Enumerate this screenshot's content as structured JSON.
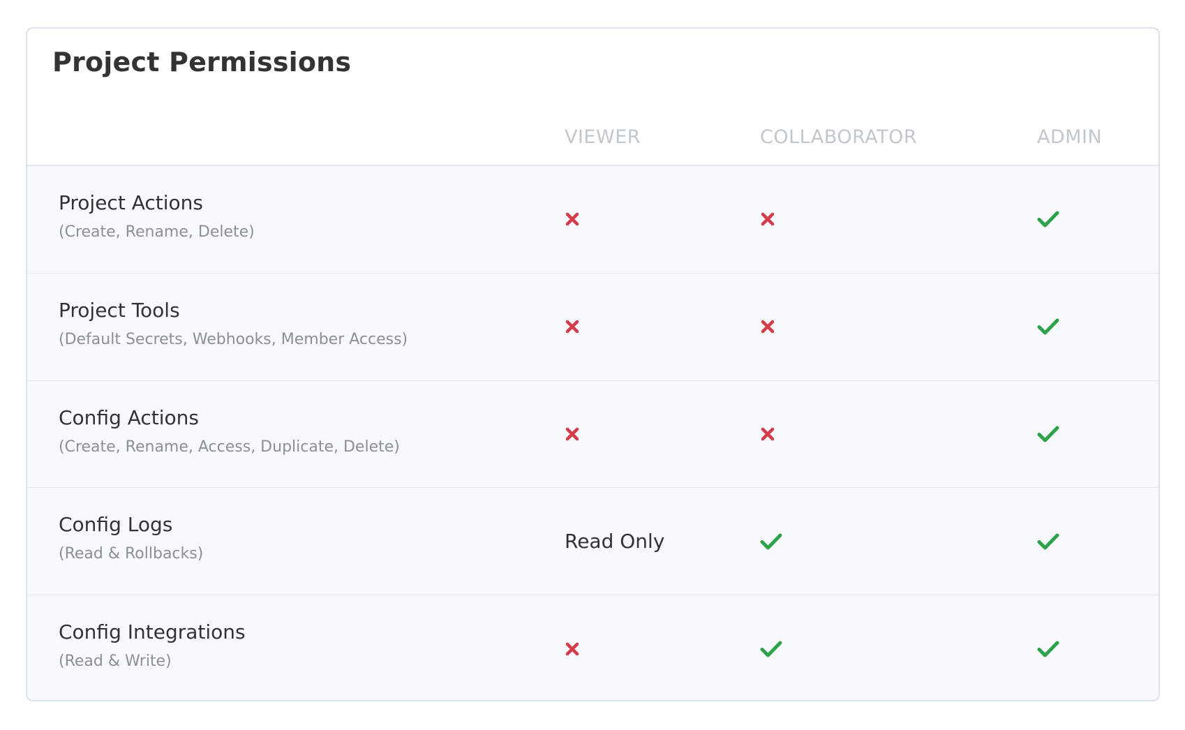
{
  "title": "Project Permissions",
  "columns": [
    "VIEWER",
    "COLLABORATOR",
    "ADMIN"
  ],
  "colors": {
    "allowed": "#2ea24a",
    "denied": "#d73a49",
    "header_text": "#c2c7cc",
    "row_background": "#f7f9fc"
  },
  "rows": [
    {
      "name": "Project Actions",
      "detail": "(Create, Rename, Delete)",
      "viewer": "denied",
      "collaborator": "denied",
      "admin": "allowed"
    },
    {
      "name": "Project Tools",
      "detail": "(Default Secrets, Webhooks, Member Access)",
      "viewer": "denied",
      "collaborator": "denied",
      "admin": "allowed"
    },
    {
      "name": "Config Actions",
      "detail": "(Create, Rename, Access, Duplicate, Delete)",
      "viewer": "denied",
      "collaborator": "denied",
      "admin": "allowed"
    },
    {
      "name": "Config Logs",
      "detail": "(Read & Rollbacks)",
      "viewer": "Read Only",
      "collaborator": "allowed",
      "admin": "allowed"
    },
    {
      "name": "Config Integrations",
      "detail": "(Read & Write)",
      "viewer": "denied",
      "collaborator": "allowed",
      "admin": "allowed"
    }
  ]
}
